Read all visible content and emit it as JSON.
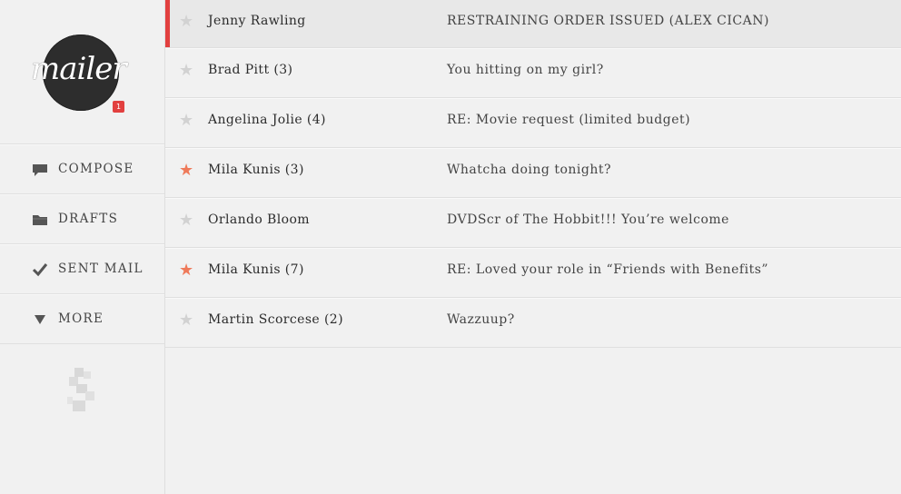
{
  "app": {
    "logo_text": "mailer",
    "badge_count": "1"
  },
  "nav": [
    {
      "label": "COMPOSE",
      "icon": "speech-bubble-icon"
    },
    {
      "label": "DRAFTS",
      "icon": "folder-icon"
    },
    {
      "label": "SENT MAIL",
      "icon": "checkmark-icon"
    },
    {
      "label": "MORE",
      "icon": "triangle-down-icon"
    }
  ],
  "messages": [
    {
      "sender": "Jenny Rawling",
      "subject": "RESTRAINING ORDER ISSUED (ALEX CICAN)",
      "starred": false,
      "active": true
    },
    {
      "sender": "Brad Pitt (3)",
      "subject": "You hitting on my girl?",
      "starred": false,
      "active": false
    },
    {
      "sender": "Angelina Jolie (4)",
      "subject": "RE: Movie request (limited budget)",
      "starred": false,
      "active": false
    },
    {
      "sender": "Mila Kunis (3)",
      "subject": "Whatcha doing tonight?",
      "starred": true,
      "active": false
    },
    {
      "sender": "Orlando Bloom",
      "subject": "DVDScr of The Hobbit!!! You’re welcome",
      "starred": false,
      "active": false
    },
    {
      "sender": "Mila Kunis (7)",
      "subject": "RE: Loved your role in “Friends with Benefits”",
      "starred": true,
      "active": false
    },
    {
      "sender": "Martin Scorcese (2)",
      "subject": "Wazzuup?",
      "starred": false,
      "active": false
    }
  ],
  "colors": {
    "accent": "#e2403f",
    "star_on": "#ef7a5a",
    "star_off": "#d2d2d2"
  }
}
